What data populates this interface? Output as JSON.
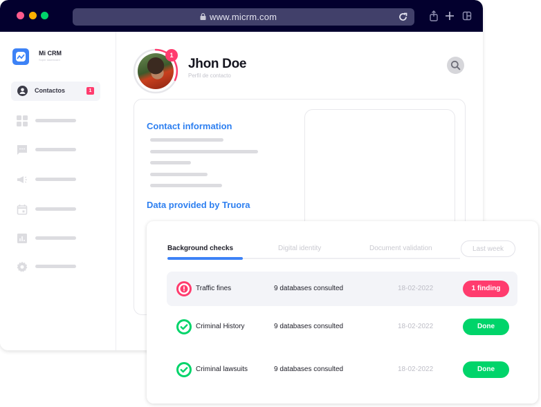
{
  "browser": {
    "url": "www.micrm.com",
    "colors": {
      "titlebar": "#03002e",
      "urlbar": "#41406a"
    }
  },
  "sidebar": {
    "brand": "Mi CRM",
    "brand_sub": "Super dashboard",
    "active_item": {
      "label": "Contactos",
      "badge": "1",
      "icon": "user-circle-icon"
    },
    "items": [
      {
        "icon": "grid-icon"
      },
      {
        "icon": "chat-icon"
      },
      {
        "icon": "megaphone-icon"
      },
      {
        "icon": "calendar-icon"
      },
      {
        "icon": "chart-icon"
      },
      {
        "icon": "gear-icon"
      }
    ]
  },
  "profile": {
    "name": "Jhon Doe",
    "subtitle": "Perfil de contacto",
    "notification_count": "1"
  },
  "contact_card": {
    "contact_title": "Contact information",
    "data_title": "Data provided by Truora"
  },
  "checks": {
    "tabs": [
      {
        "label": "Background checks",
        "active": true
      },
      {
        "label": "Digital identity",
        "active": false
      },
      {
        "label": "Document validation",
        "active": false
      }
    ],
    "filter": "Last week",
    "rows": [
      {
        "name": "Traffic fines",
        "databases": "9 databases consulted",
        "date": "18-02-2022",
        "status": "1 finding",
        "state": "warning"
      },
      {
        "name": "Criminal History",
        "databases": "9 databases consulted",
        "date": "18-02-2022",
        "status": "Done",
        "state": "ok"
      },
      {
        "name": "Criminal lawsuits",
        "databases": "9 databases consulted",
        "date": "18-02-2022",
        "status": "Done",
        "state": "ok"
      }
    ],
    "colors": {
      "accent": "#3d82f6",
      "warning": "#ff3c6e",
      "ok": "#00d46a",
      "heading": "#2d7ff0"
    }
  }
}
